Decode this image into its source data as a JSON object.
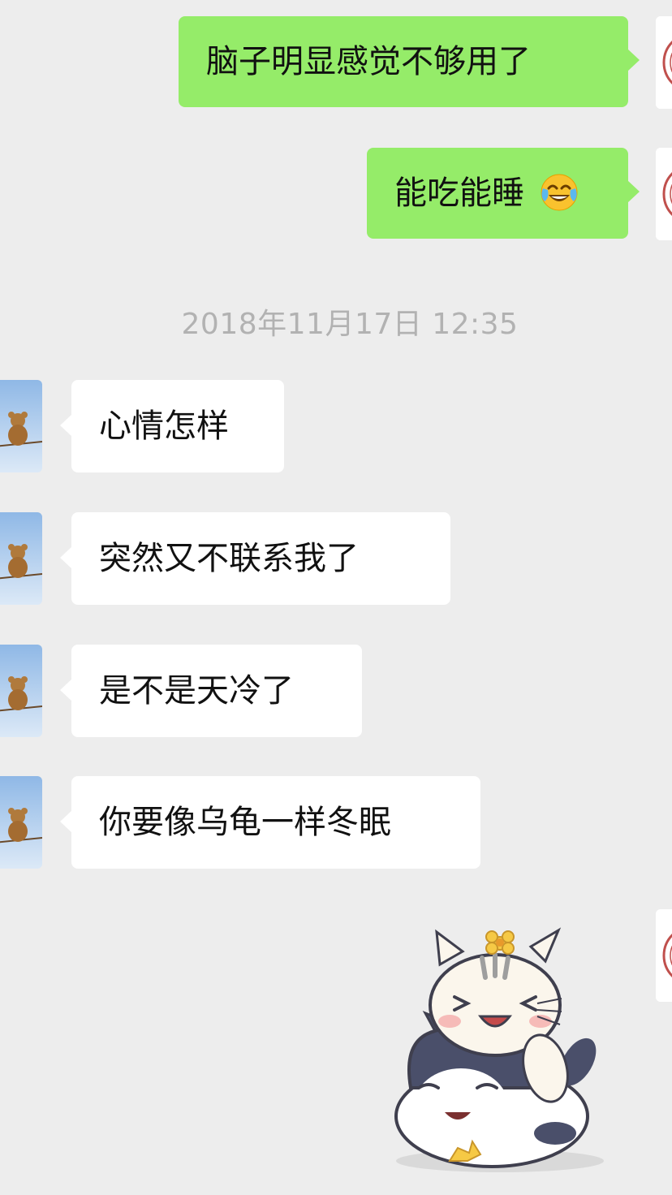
{
  "messages": [
    {
      "side": "right",
      "text": "脑子明显感觉不够用了"
    },
    {
      "side": "right",
      "text": "能吃能睡",
      "emoji": "face-with-tears-of-joy-emoji"
    },
    {
      "side": "left",
      "text": "心情怎样"
    },
    {
      "side": "left",
      "text": "突然又不联系我了"
    },
    {
      "side": "left",
      "text": "是不是天冷了"
    },
    {
      "side": "left",
      "text": "你要像乌龟一样冬眠"
    },
    {
      "side": "right",
      "sticker": "two-cartoon-cats-sticker"
    }
  ],
  "timestamp": "2018年11月17日 12:35",
  "colors": {
    "background": "#ededed",
    "outgoing_bubble": "#95ec69",
    "incoming_bubble": "#ffffff",
    "timestamp_text": "#b2b2b2"
  },
  "avatars": {
    "self": "seal-stamp-avatar",
    "other": "teddy-bear-sky-avatar"
  }
}
